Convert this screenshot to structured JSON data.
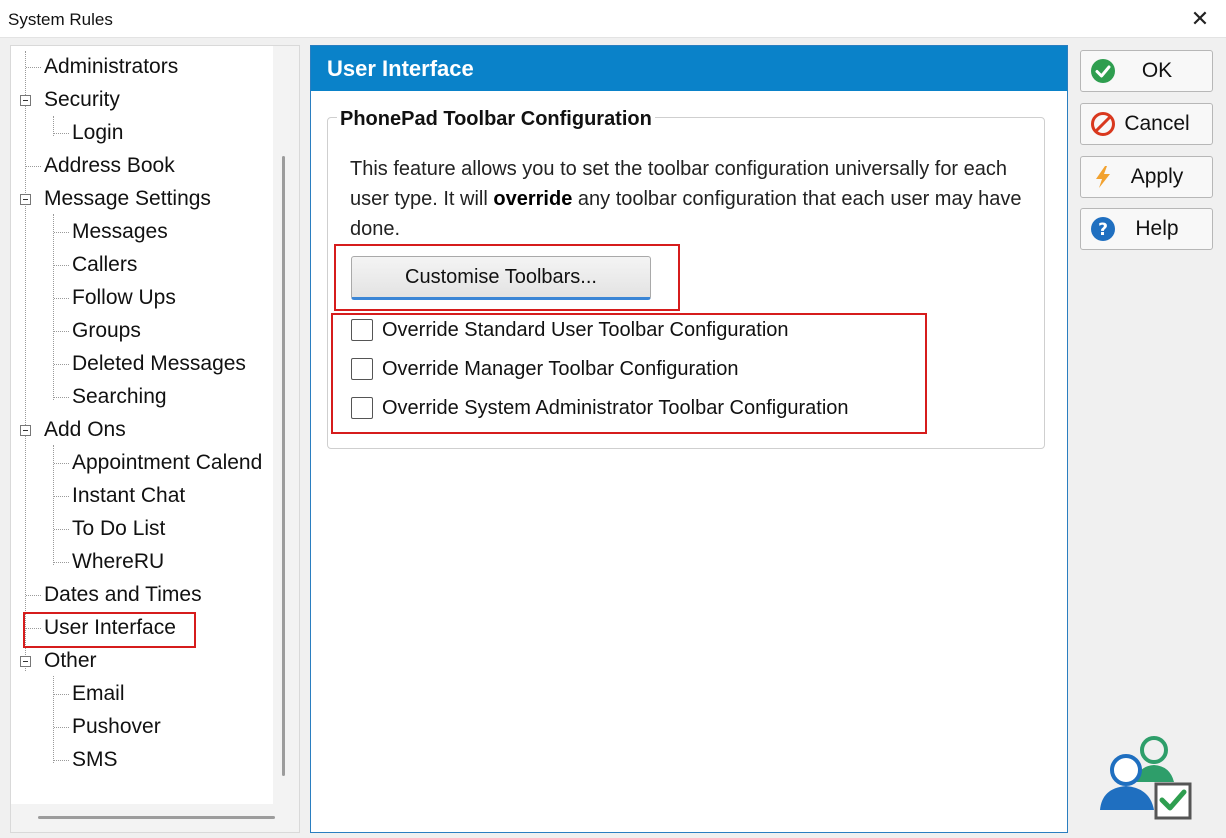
{
  "window": {
    "title": "System Rules",
    "close_glyph": "✕"
  },
  "tree": {
    "items": [
      {
        "label": "Administrators"
      },
      {
        "label": "Security"
      },
      {
        "label": "Login"
      },
      {
        "label": "Address Book"
      },
      {
        "label": "Message Settings"
      },
      {
        "label": "Messages"
      },
      {
        "label": "Callers"
      },
      {
        "label": "Follow Ups"
      },
      {
        "label": "Groups"
      },
      {
        "label": "Deleted Messages"
      },
      {
        "label": "Searching"
      },
      {
        "label": "Add Ons"
      },
      {
        "label": "Appointment Calend"
      },
      {
        "label": "Instant Chat"
      },
      {
        "label": "To Do List"
      },
      {
        "label": "WhereRU"
      },
      {
        "label": "Dates and Times"
      },
      {
        "label": "User Interface"
      },
      {
        "label": "Other"
      },
      {
        "label": "Email"
      },
      {
        "label": "Pushover"
      },
      {
        "label": "SMS"
      }
    ],
    "selected": "User Interface"
  },
  "panel": {
    "header": "User Interface",
    "group_title": "PhonePad Toolbar Configuration",
    "desc_part1": "This feature allows you to set the toolbar configuration universally for each user type. It will ",
    "desc_bold": "override",
    "desc_part2": " any toolbar configuration that each user may have done.",
    "customise_button": "Customise Toolbars...",
    "checkboxes": [
      {
        "label": "Override Standard User Toolbar Configuration",
        "checked": false
      },
      {
        "label": "Override Manager Toolbar Configuration",
        "checked": false
      },
      {
        "label": "Override System Administrator Toolbar Configuration",
        "checked": false
      }
    ]
  },
  "buttons": {
    "ok": "OK",
    "cancel": "Cancel",
    "apply": "Apply",
    "help": "Help"
  },
  "icons": {
    "ok": "check-circle-icon",
    "cancel": "prohibited-icon",
    "apply": "lightning-icon",
    "help": "question-circle-icon",
    "logo": "users-check-icon"
  },
  "colors": {
    "header_blue": "#0a82c9",
    "highlight_red": "#d61c1c",
    "ok_green": "#2e9e4f",
    "cancel_red": "#d9381e",
    "apply_orange": "#f2a230",
    "help_blue": "#1f6fc0"
  }
}
